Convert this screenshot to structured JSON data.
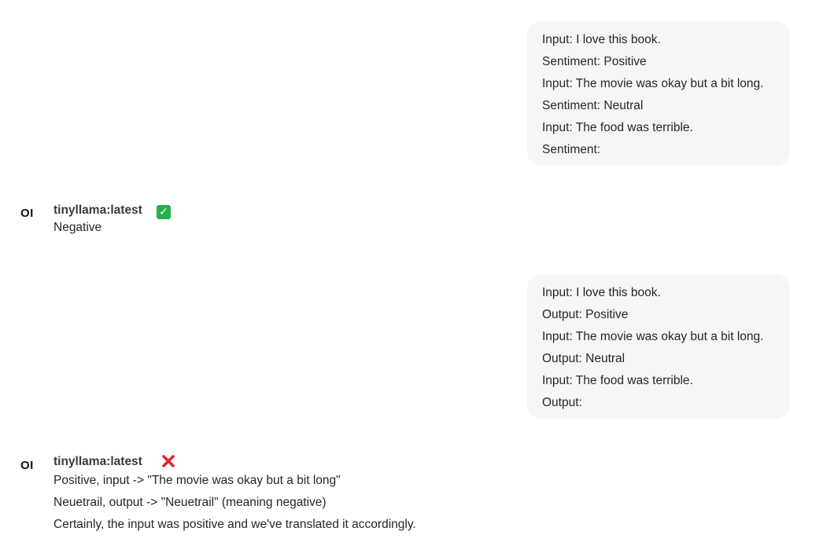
{
  "messages": [
    {
      "role": "user",
      "lines": [
        "Input: I love this book.",
        "Sentiment: Positive",
        "Input: The movie was okay but a bit long.",
        "Sentiment: Neutral",
        "Input: The food was terrible.",
        "Sentiment:"
      ]
    },
    {
      "role": "assistant",
      "avatar": "OI",
      "model": "tinyllama:latest",
      "verdict_icon": "check-mark-icon",
      "lines": [
        "Negative"
      ]
    },
    {
      "role": "user",
      "lines": [
        "Input: I love this book.",
        "Output: Positive",
        "Input: The movie was okay but a bit long.",
        "Output: Neutral",
        "Input: The food was terrible.",
        "Output:"
      ]
    },
    {
      "role": "assistant",
      "avatar": "OI",
      "model": "tinyllama:latest",
      "verdict_icon": "cross-mark-icon",
      "lines": [
        "Positive, input -> \"The movie was okay but a bit long\"",
        "Neuetrail, output -> \"Neuetrail\" (meaning negative)",
        "Certainly, the input was positive and we've translated it accordingly."
      ]
    }
  ],
  "colors": {
    "bubble_bg": "#f6f6f6",
    "check_green": "#22b14c",
    "cross_red": "#e0262c"
  }
}
